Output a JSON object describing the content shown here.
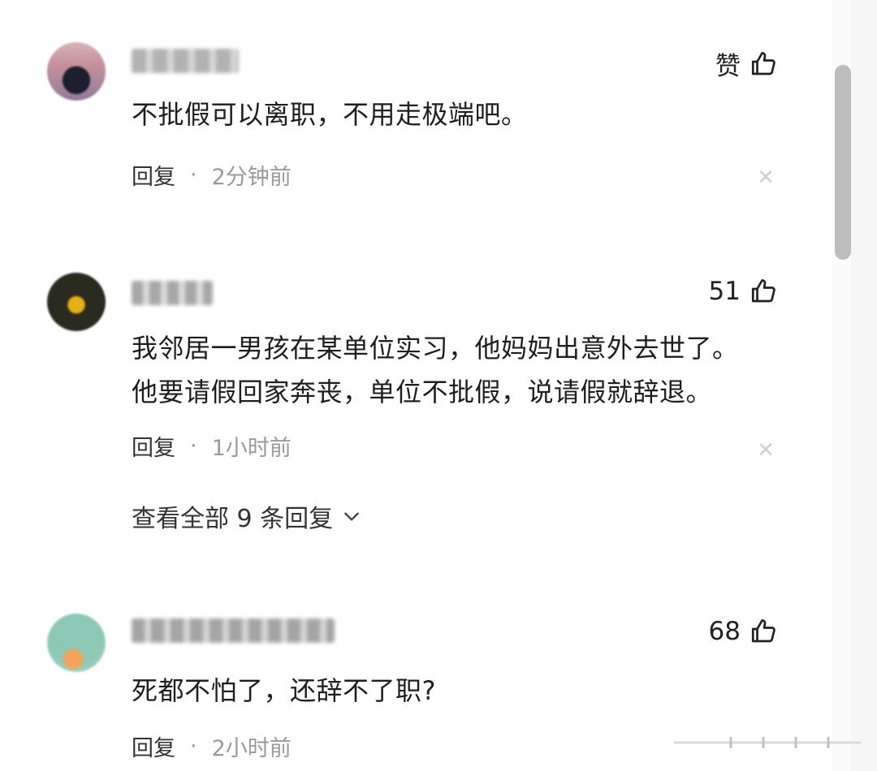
{
  "comments": [
    {
      "likes_label": "赞",
      "text": "不批假可以离职，不用走极端吧。",
      "reply_label": "回复",
      "separator": "·",
      "time": "2分钟前"
    },
    {
      "likes_label": "51",
      "text_lines": [
        "我邻居一男孩在某单位实习，他妈妈出意外去世了。",
        "他要请假回家奔丧，单位不批假，说请假就辞退。"
      ],
      "reply_label": "回复",
      "separator": "·",
      "time": "1小时前",
      "view_all_label": "查看全部 9 条回复"
    },
    {
      "likes_label": "68",
      "text": "死都不怕了，还辞不了职?",
      "reply_label": "回复",
      "separator": "·",
      "time": "2小时前"
    }
  ],
  "icons": {
    "like": "thumbs-up-icon",
    "close": "close-icon",
    "chevron": "chevron-down-icon"
  },
  "colors": {
    "text": "#1e1e1e",
    "meta": "#9a9a9a",
    "scrollbar": "#bdbdbd"
  }
}
